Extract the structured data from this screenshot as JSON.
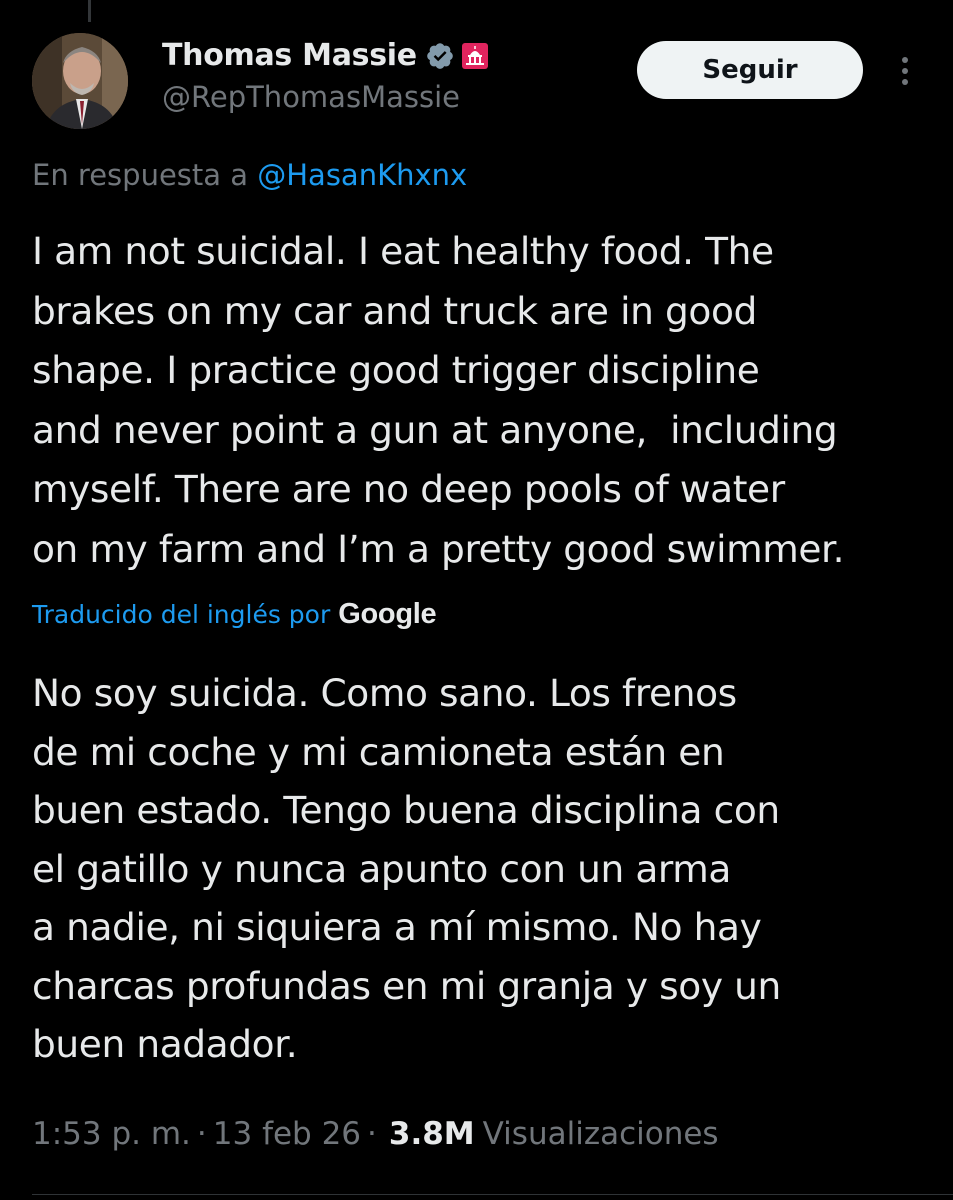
{
  "author": {
    "display_name": "Thomas Massie",
    "handle": "@RepThomasMassie",
    "verified_icon": "verified-badge-icon",
    "affiliation_icon": "us-capitol-icon"
  },
  "actions": {
    "follow_label": "Seguir",
    "more_icon": "more-vertical-icon"
  },
  "reply": {
    "prefix": "En respuesta a",
    "mention": "@HasanKhxnx"
  },
  "tweet": {
    "original_text": "I am not suicidal. I eat healthy food. The\nbrakes on my car and truck are in good\nshape. I practice good trigger discipline\nand never point a gun at anyone,  including\nmyself. There are no deep pools of water\non my farm and I’m a pretty good swimmer.",
    "translation_label": "Traducido del inglés por",
    "translation_provider": "Google",
    "translated_text": "No soy suicida. Como sano. Los frenos\nde mi coche y mi camioneta están en\nbuen estado. Tengo buena disciplina con\nel gatillo y nunca apunto con un arma\na nadie, ni siquiera a mí mismo. No hay\ncharcas profundas en mi granja y soy un\nbuen nadador."
  },
  "meta": {
    "time": "1:53 p. m.",
    "separator": "·",
    "date": "13 feb 26",
    "views_count": "3.8M",
    "views_label": "Visualizaciones"
  },
  "colors": {
    "background": "#000000",
    "text_primary": "#e7e9ea",
    "text_secondary": "#71767b",
    "link": "#1d9bf0",
    "verified": "#829aab",
    "follow_button_bg": "#eff3f4"
  }
}
